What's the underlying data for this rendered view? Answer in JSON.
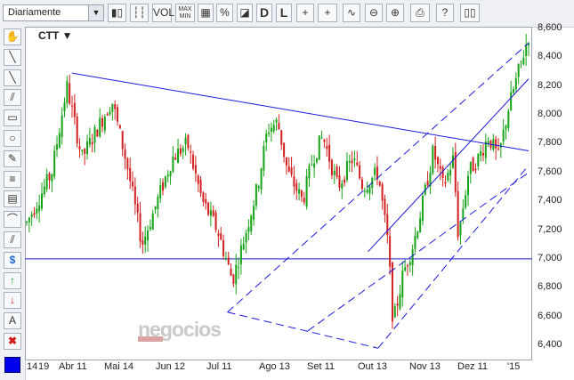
{
  "toolbar": {
    "period_select": "Diariamente",
    "buttons": [
      {
        "name": "candlestick",
        "label": "▮▯"
      },
      {
        "name": "bars",
        "label": "┆┆"
      },
      {
        "name": "vol",
        "label": "VOL"
      },
      {
        "name": "maxmin",
        "label": "MAX MIN"
      },
      {
        "name": "grid",
        "label": "▦"
      },
      {
        "name": "percent",
        "label": "%"
      },
      {
        "name": "area",
        "label": "◪"
      },
      {
        "name": "d",
        "label": "D"
      },
      {
        "name": "l",
        "label": "L"
      },
      {
        "name": "crosshair",
        "label": "+"
      },
      {
        "name": "crosshair2",
        "label": "+"
      },
      {
        "name": "trend",
        "label": "∿"
      },
      {
        "name": "zoom-out",
        "label": "⊖"
      },
      {
        "name": "zoom-in",
        "label": "⊕"
      },
      {
        "name": "print",
        "label": "⎙"
      },
      {
        "name": "help",
        "label": "?"
      },
      {
        "name": "book",
        "label": "▯▯"
      }
    ]
  },
  "sidebar": {
    "tools": [
      "hand",
      "line",
      "ray",
      "parallel",
      "rect",
      "ellipse",
      "pencil",
      "fib",
      "grid",
      "arc",
      "diag",
      "dollar",
      "up-arrow",
      "down-arrow",
      "text",
      "delete"
    ]
  },
  "chart": {
    "ticker": "CTT ▼",
    "watermark": "negocios",
    "y_ticks": [
      "8,600",
      "8,400",
      "8,200",
      "8,000",
      "7,800",
      "7,600",
      "7,400",
      "7,200",
      "7,000",
      "6,800",
      "6,600",
      "6,400"
    ],
    "x_ticks": [
      "14",
      "19",
      "Abr 11",
      "Mai 14",
      "Jun 12",
      "Jul 11",
      "Ago 13",
      "Set 11",
      "Out 13",
      "Nov 13",
      "Dez 11",
      "'15"
    ],
    "colors": {
      "up": "#17a317",
      "down": "#d21f1f",
      "line": "#1a1adc"
    }
  },
  "chart_data": {
    "type": "candlestick",
    "ticker": "CTT",
    "ylim": [
      6.4,
      8.6
    ],
    "y_ticks": [
      8.6,
      8.4,
      8.2,
      8.0,
      7.8,
      7.6,
      7.4,
      7.2,
      7.0,
      6.8,
      6.6,
      6.4
    ],
    "horizontal_line": 7.0,
    "anchors": [
      {
        "x": 0,
        "v": 7.25
      },
      {
        "x": 0.05,
        "v": 7.6
      },
      {
        "x": 0.08,
        "v": 8.2
      },
      {
        "x": 0.11,
        "v": 7.7
      },
      {
        "x": 0.14,
        "v": 7.9
      },
      {
        "x": 0.17,
        "v": 8.1
      },
      {
        "x": 0.2,
        "v": 7.65
      },
      {
        "x": 0.23,
        "v": 7.1
      },
      {
        "x": 0.26,
        "v": 7.4
      },
      {
        "x": 0.29,
        "v": 7.7
      },
      {
        "x": 0.32,
        "v": 7.8
      },
      {
        "x": 0.35,
        "v": 7.4
      },
      {
        "x": 0.38,
        "v": 7.2
      },
      {
        "x": 0.41,
        "v": 6.85
      },
      {
        "x": 0.43,
        "v": 7.1
      },
      {
        "x": 0.46,
        "v": 7.5
      },
      {
        "x": 0.48,
        "v": 7.9
      },
      {
        "x": 0.5,
        "v": 7.95
      },
      {
        "x": 0.52,
        "v": 7.6
      },
      {
        "x": 0.55,
        "v": 7.4
      },
      {
        "x": 0.57,
        "v": 7.7
      },
      {
        "x": 0.59,
        "v": 7.85
      },
      {
        "x": 0.62,
        "v": 7.5
      },
      {
        "x": 0.65,
        "v": 7.7
      },
      {
        "x": 0.67,
        "v": 7.5
      },
      {
        "x": 0.7,
        "v": 7.6
      },
      {
        "x": 0.72,
        "v": 7.1
      },
      {
        "x": 0.73,
        "v": 6.55
      },
      {
        "x": 0.75,
        "v": 6.9
      },
      {
        "x": 0.77,
        "v": 7.1
      },
      {
        "x": 0.79,
        "v": 7.4
      },
      {
        "x": 0.81,
        "v": 7.75
      },
      {
        "x": 0.83,
        "v": 7.5
      },
      {
        "x": 0.85,
        "v": 7.7
      },
      {
        "x": 0.86,
        "v": 7.15
      },
      {
        "x": 0.88,
        "v": 7.6
      },
      {
        "x": 0.9,
        "v": 7.7
      },
      {
        "x": 0.92,
        "v": 7.85
      },
      {
        "x": 0.94,
        "v": 7.7
      },
      {
        "x": 0.96,
        "v": 8.05
      },
      {
        "x": 0.98,
        "v": 8.3
      },
      {
        "x": 1,
        "v": 8.55
      }
    ],
    "trendlines": [
      {
        "from": {
          "x": 0.09,
          "v": 8.29
        },
        "to": {
          "x": 1,
          "v": 7.75
        },
        "style": "solid"
      },
      {
        "from": {
          "x": 0.4,
          "v": 6.63
        },
        "to": {
          "x": 1,
          "v": 8.5
        },
        "style": "dashed"
      },
      {
        "from": {
          "x": 0.4,
          "v": 6.63
        },
        "to": {
          "x": 0.7,
          "v": 6.38
        },
        "style": "dashed"
      },
      {
        "from": {
          "x": 0.7,
          "v": 6.38
        },
        "to": {
          "x": 1,
          "v": 7.65
        },
        "style": "dashed"
      },
      {
        "from": {
          "x": 0.56,
          "v": 6.5
        },
        "to": {
          "x": 1,
          "v": 7.6
        },
        "style": "dashed"
      },
      {
        "from": {
          "x": 0.68,
          "v": 7.05
        },
        "to": {
          "x": 1,
          "v": 8.25
        },
        "style": "solid"
      }
    ]
  }
}
